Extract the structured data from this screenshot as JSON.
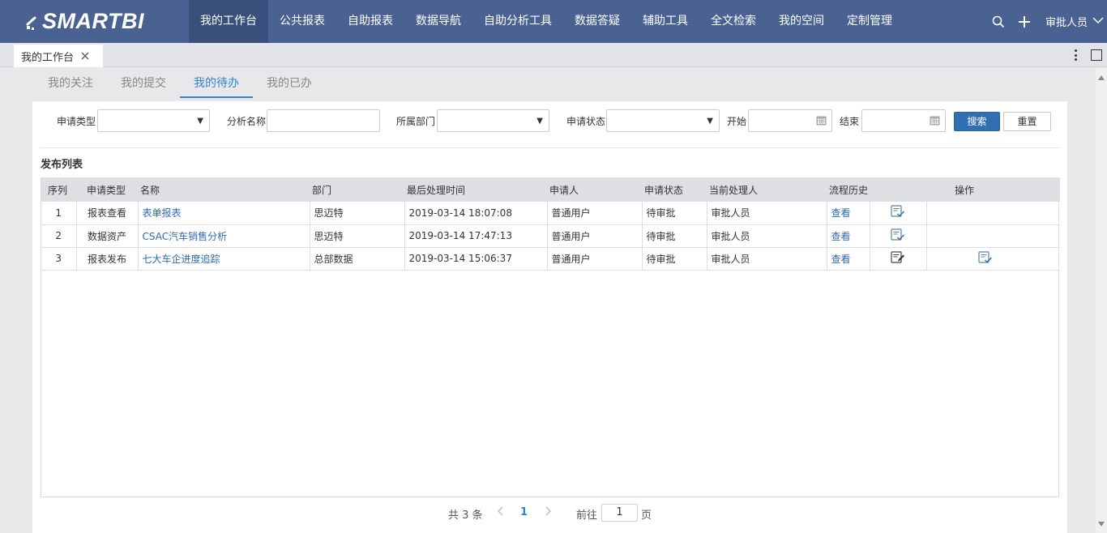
{
  "app": {
    "logo_text": "SMARTBI"
  },
  "nav": {
    "items": [
      {
        "label": "我的工作台",
        "active": true
      },
      {
        "label": "公共报表"
      },
      {
        "label": "自助报表"
      },
      {
        "label": "数据导航"
      },
      {
        "label": "自助分析工具"
      },
      {
        "label": "数据答疑"
      },
      {
        "label": "辅助工具"
      },
      {
        "label": "全文检索"
      },
      {
        "label": "我的空间"
      },
      {
        "label": "定制管理"
      }
    ],
    "user": "审批人员",
    "icons": [
      "search-icon",
      "plus-icon",
      "chevron-down-icon"
    ]
  },
  "tabstrip": {
    "tab_label": "我的工作台"
  },
  "subtabs": [
    {
      "label": "我的关注"
    },
    {
      "label": "我的提交"
    },
    {
      "label": "我的待办",
      "active": true
    },
    {
      "label": "我的已办"
    }
  ],
  "filters": {
    "apply_type_label": "申请类型",
    "analysis_name_label": "分析名称",
    "dept_label": "所属部门",
    "status_label": "申请状态",
    "start_label": "开始",
    "end_label": "结束",
    "search_button": "搜索",
    "reset_button": "重置"
  },
  "list": {
    "title": "发布列表",
    "columns": [
      "序列",
      "申请类型",
      "名称",
      "部门",
      "最后处理时间",
      "申请人",
      "申请状态",
      "当前处理人",
      "流程历史",
      "",
      "操作"
    ],
    "view_label": "查看",
    "rows": [
      {
        "seq": "1",
        "type": "报表查看",
        "name": "表单报表",
        "dept": "思迈特",
        "time": "2019-03-14 18:07:08",
        "applicant": "普通用户",
        "status": "待审批",
        "handler": "审批人员",
        "history": "查看",
        "ops": [
          "approve-icon"
        ]
      },
      {
        "seq": "2",
        "type": "数据资产",
        "name": "CSAC汽车销售分析",
        "dept": "思迈特",
        "time": "2019-03-14 17:47:13",
        "applicant": "普通用户",
        "status": "待审批",
        "handler": "审批人员",
        "history": "查看",
        "ops": [
          "approve-icon"
        ]
      },
      {
        "seq": "3",
        "type": "报表发布",
        "name": "七大车企进度追踪",
        "dept": "总部数据",
        "time": "2019-03-14 15:06:37",
        "applicant": "普通用户",
        "status": "待审批",
        "handler": "审批人员",
        "history": "查看",
        "ops": [
          "edit-icon",
          "approve-icon"
        ]
      }
    ]
  },
  "pagination": {
    "total_text": "共 3 条",
    "current_page": "1",
    "goto_label": "前往",
    "goto_value": "1",
    "page_suffix": "页"
  },
  "colors": {
    "nav_bg": "#4a6291",
    "nav_active": "#38507a",
    "accent": "#2f86c8",
    "link": "#2e6ab0",
    "primary_button": "#2f6fb2"
  }
}
